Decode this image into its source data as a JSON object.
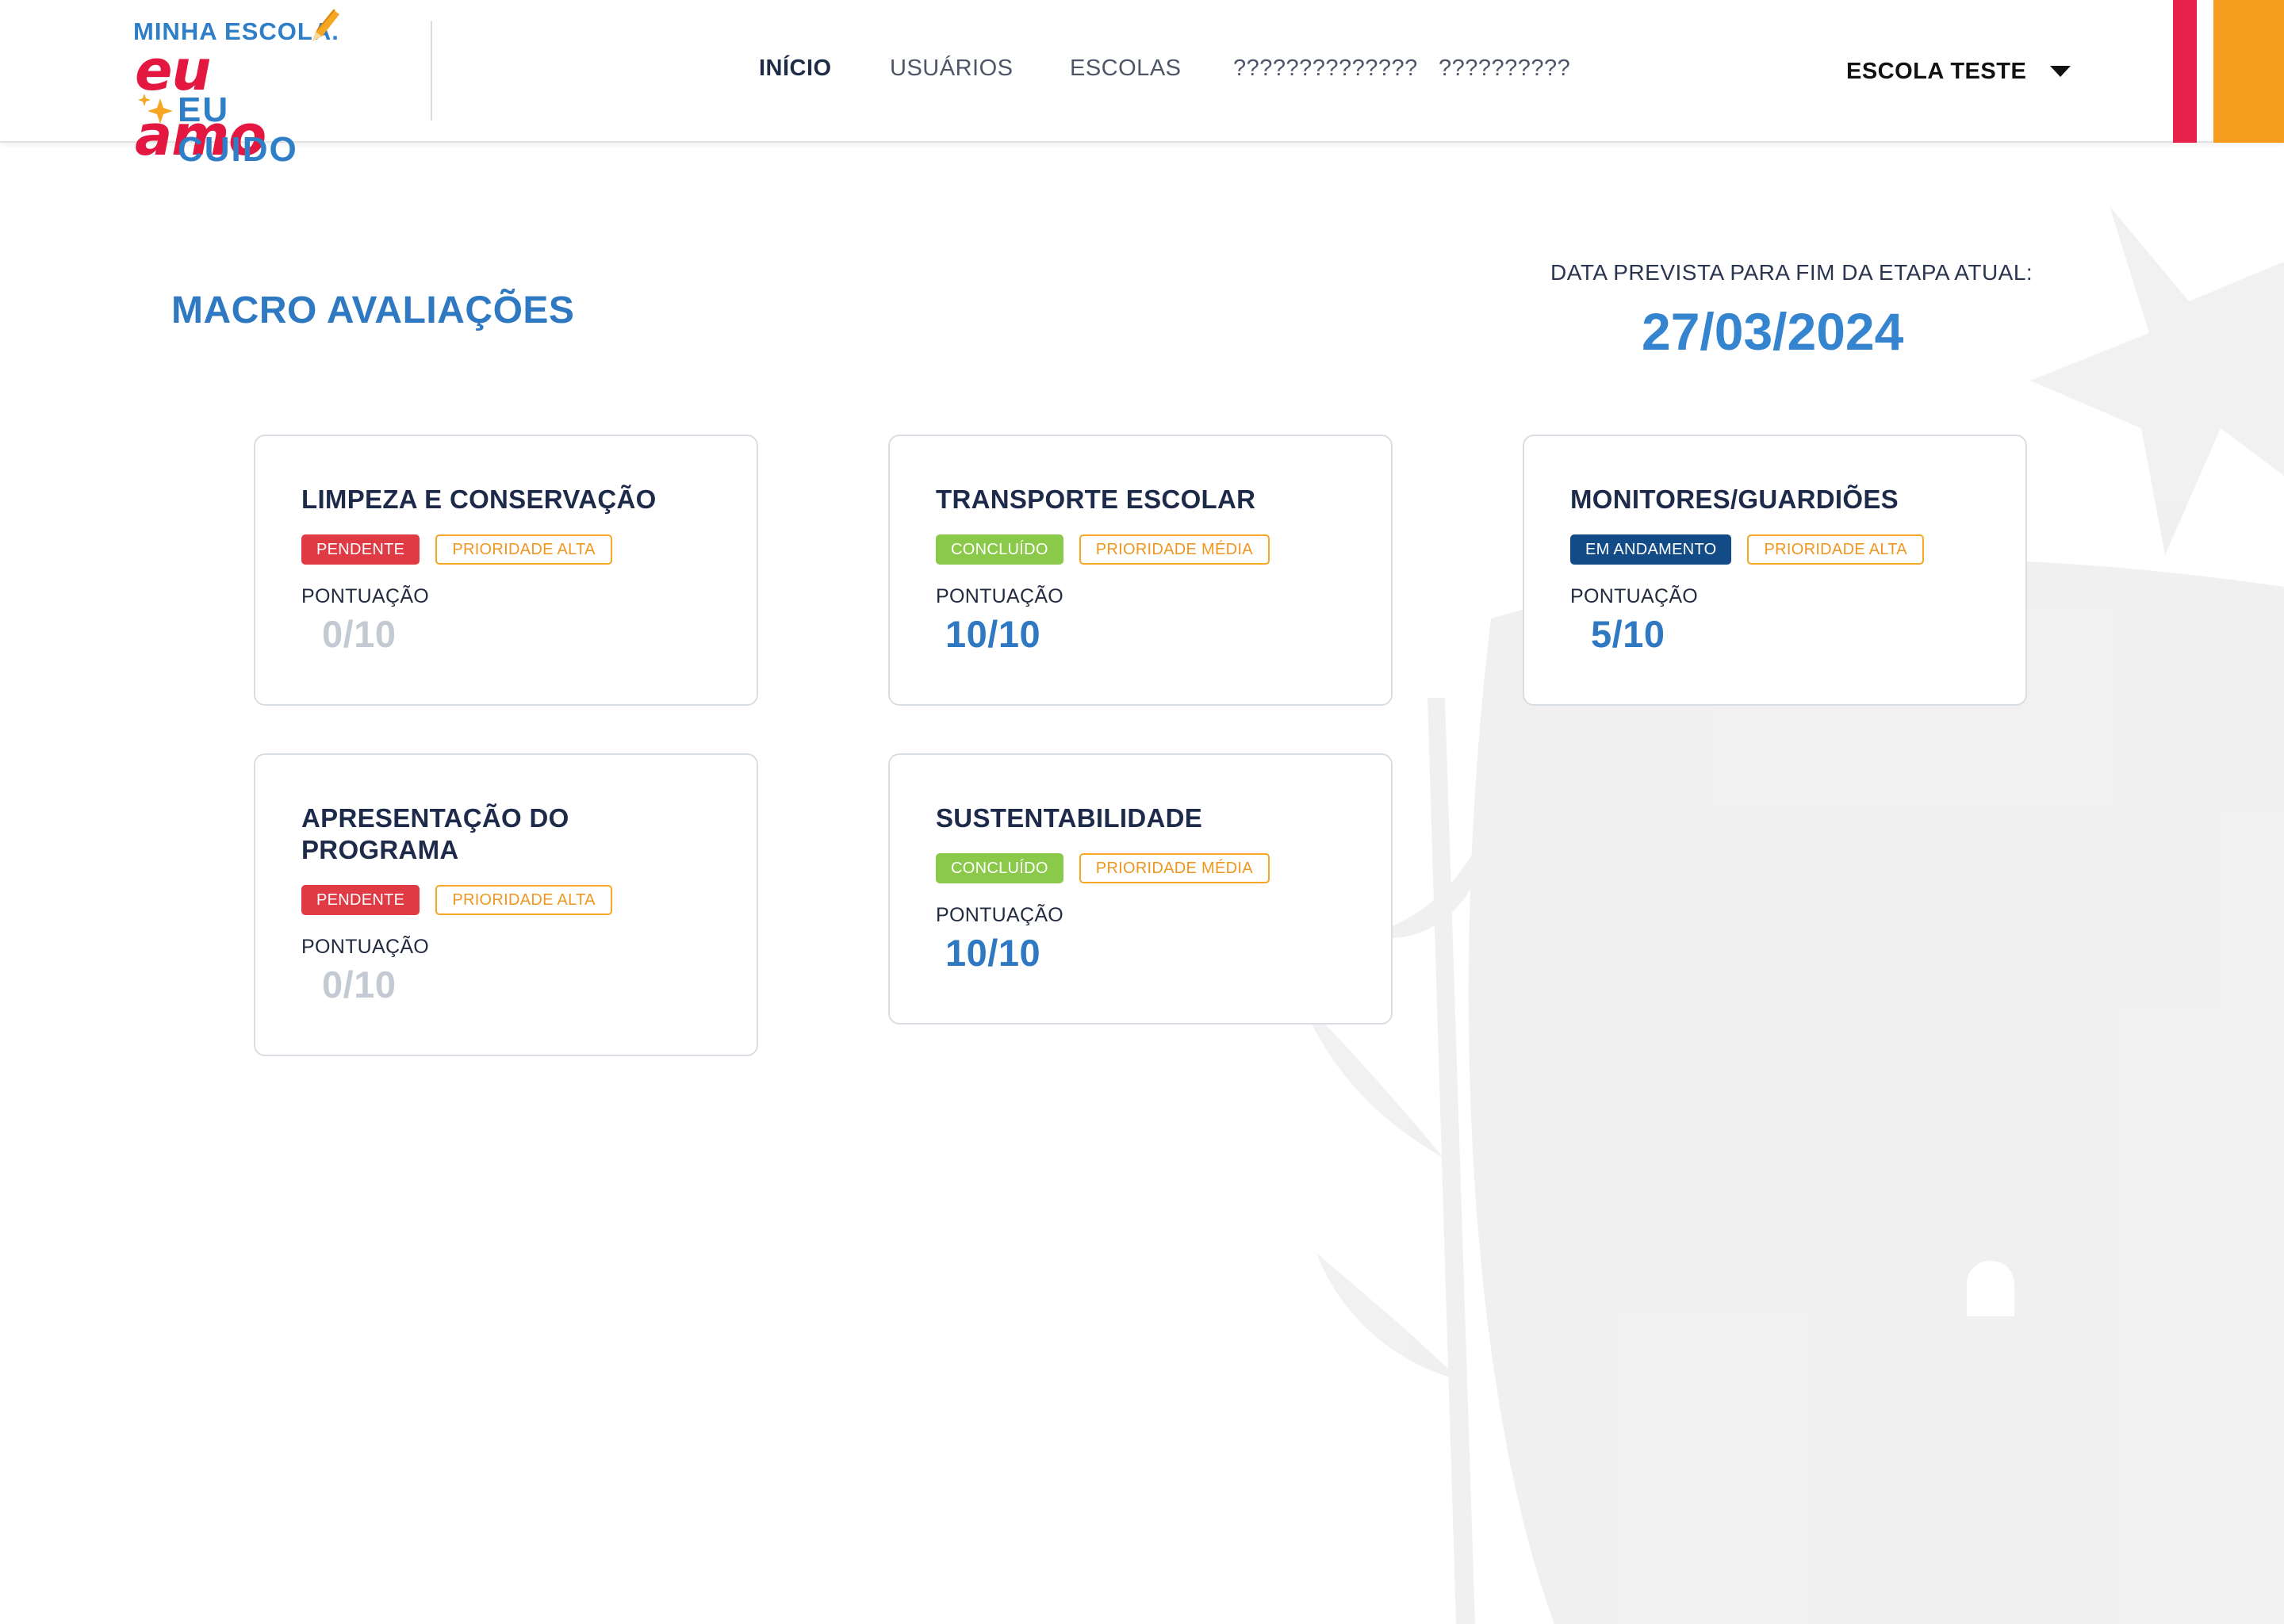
{
  "logo": {
    "line1": "MINHA ESCOLA.",
    "line2": "eu amo",
    "line3": "EU CUIDO"
  },
  "nav": {
    "items": [
      {
        "label": "INÍCIO",
        "active": true
      },
      {
        "label": "USUÁRIOS",
        "active": false
      },
      {
        "label": "ESCOLAS",
        "active": false
      },
      {
        "label": "??????????????",
        "active": false
      },
      {
        "label": "??????????",
        "active": false
      }
    ]
  },
  "school_selector": {
    "value": "ESCOLA TESTE",
    "icon": "caret-down-icon"
  },
  "main": {
    "title": "MACRO AVALIAÇÕES",
    "deadline_label": "DATA PREVISTA PARA FIM DA ETAPA ATUAL:",
    "deadline_date": "27/03/2024"
  },
  "cards": [
    {
      "title": "LIMPEZA E CONSERVAÇÃO",
      "status": "PENDENTE",
      "priority": "PRIORIDADE ALTA",
      "score_label": "PONTUAÇÃO",
      "score": "0/10"
    },
    {
      "title": "TRANSPORTE ESCOLAR",
      "status": "CONCLUÍDO",
      "priority": "PRIORIDADE MÉDIA",
      "score_label": "PONTUAÇÃO",
      "score": "10/10"
    },
    {
      "title": "MONITORES/GUARDIÕES",
      "status": "EM ANDAMENTO",
      "priority": "PRIORIDADE ALTA",
      "score_label": "PONTUAÇÃO",
      "score": "5/10"
    },
    {
      "title": "APRESENTAÇÃO DO PROGRAMA",
      "status": "PENDENTE",
      "priority": "PRIORIDADE ALTA",
      "score_label": "PONTUAÇÃO",
      "score": "0/10"
    },
    {
      "title": "SUSTENTABILIDADE",
      "status": "CONCLUÍDO",
      "priority": "PRIORIDADE MÉDIA",
      "score_label": "PONTUAÇÃO",
      "score": "10/10"
    }
  ],
  "colors": {
    "accent_blue": "#2f78c2",
    "score_blue": "#2f78c2",
    "score_zero": "#c4cad3",
    "status_pending": "#e03a45",
    "status_done": "#8bc94a",
    "status_in_progress": "#124b86",
    "priority_border": "#f5a623",
    "stripe_red": "#e8214b",
    "stripe_orange": "#f59b1d"
  }
}
